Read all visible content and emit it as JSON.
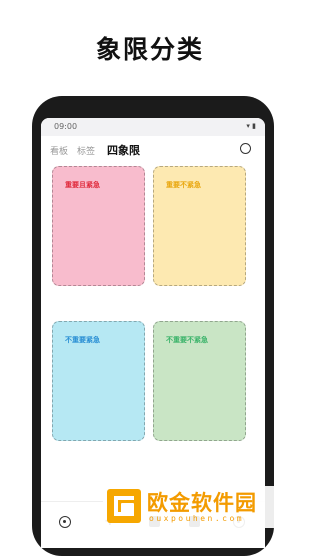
{
  "headline": "象限分类",
  "status": {
    "time": "09:00",
    "signal": "▾ ▮"
  },
  "tabs": [
    {
      "label": "看板",
      "active": false
    },
    {
      "label": "标签",
      "active": false
    },
    {
      "label": "四象限",
      "active": true
    }
  ],
  "quadrants": [
    {
      "label": "重要且紧急",
      "color": "#f8bccd"
    },
    {
      "label": "重要不紧急",
      "color": "#fde9b1"
    },
    {
      "label": "不重要紧急",
      "color": "#b6e8f3"
    },
    {
      "label": "不重要不紧急",
      "color": "#c9e5c5"
    }
  ],
  "bottom_nav": {
    "icons": [
      "target-icon",
      "add-icon",
      "square-icon",
      "square-icon",
      "circle-dot-icon"
    ]
  },
  "watermark": {
    "name": "欧金软件园",
    "url": "ouxpouhen.com",
    "color": "#f39b00"
  }
}
